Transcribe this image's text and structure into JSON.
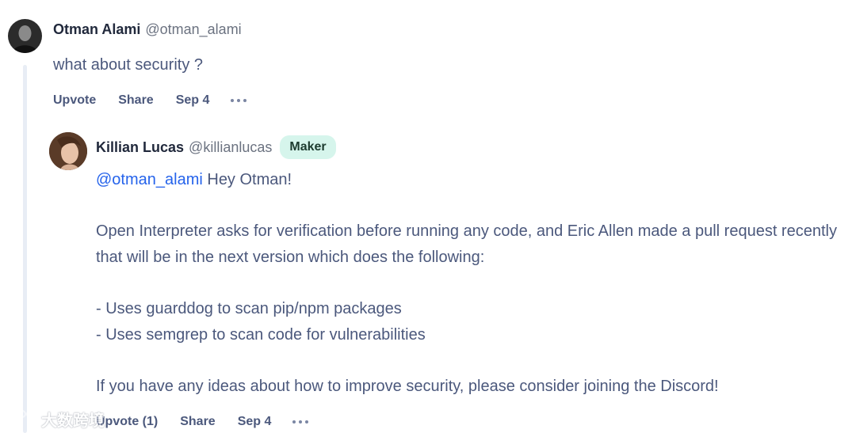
{
  "top_comment": {
    "author_name": "Otman Alami",
    "author_handle": "@otman_alami",
    "text": "what about security ?",
    "actions": {
      "upvote_label": "Upvote",
      "share_label": "Share",
      "date": "Sep 4"
    }
  },
  "reply": {
    "author_name": "Killian Lucas",
    "author_handle": "@killianlucas",
    "badge": "Maker",
    "mention": "@otman_alami",
    "greeting": " Hey Otman!",
    "paragraphs": [
      "Open Interpreter asks for verification before running any code, and Eric Allen made a pull request recently that will be in the next version which does the following:",
      "- Uses guarddog to scan pip/npm packages\n- Uses semgrep to scan code for vulnerabilities",
      "If you have any ideas about how to improve security, please consider joining the Discord!"
    ],
    "actions": {
      "upvote_label": "Upvote (1)",
      "share_label": "Share",
      "date": "Sep 4"
    }
  },
  "watermark": {
    "text": "大数跨境",
    "icon": "chat-bubble-logo-icon"
  },
  "colors": {
    "text": "#4b587c",
    "name": "#21293c",
    "mention": "#2563eb",
    "badge_bg": "#d6f5ec",
    "thread_line": "#e8edf5"
  }
}
